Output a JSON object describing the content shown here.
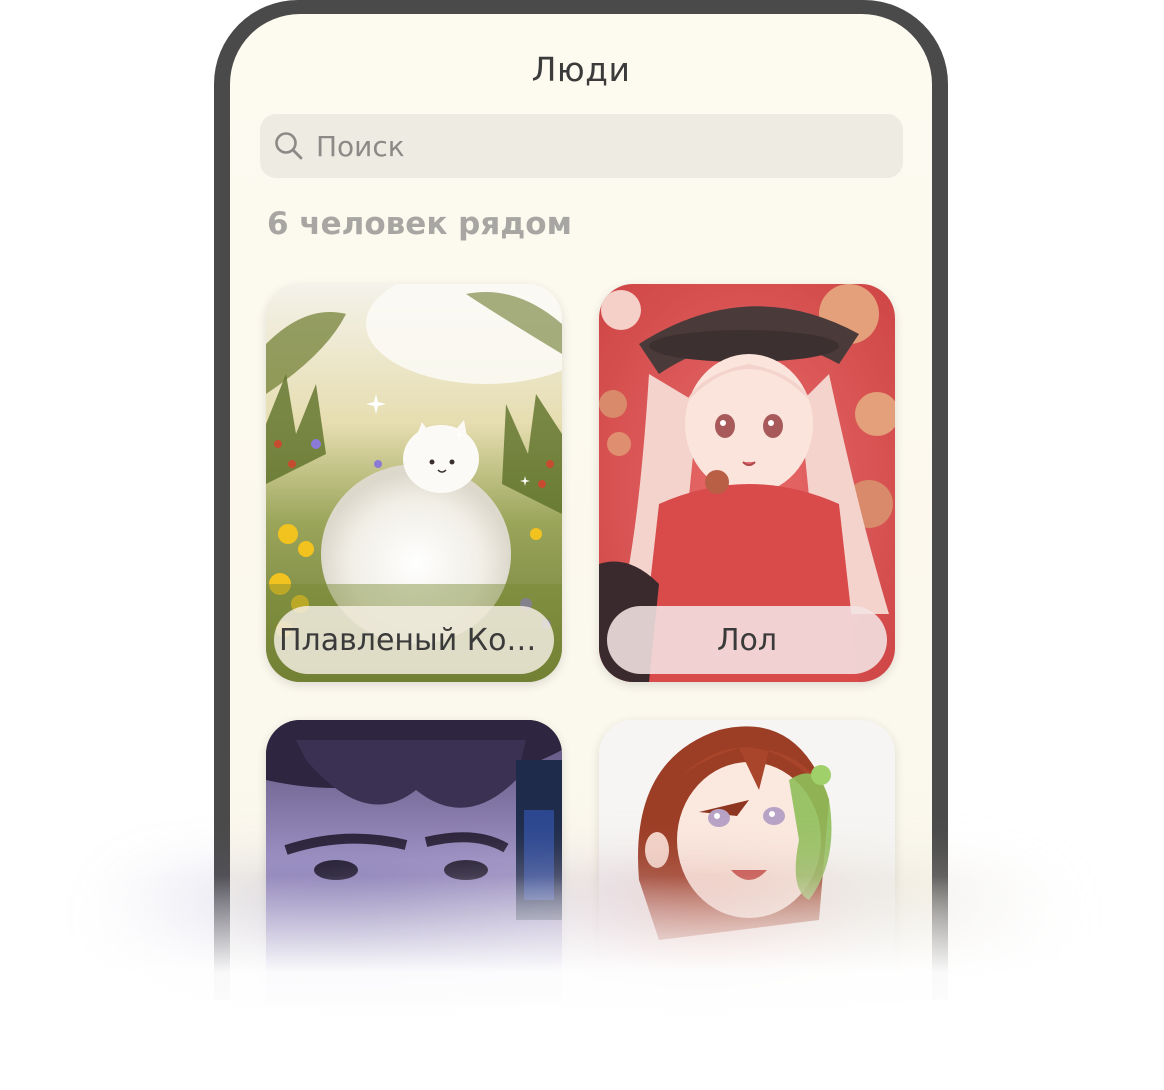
{
  "header": {
    "title": "Люди"
  },
  "search": {
    "placeholder": "Поиск",
    "icon": "search-icon"
  },
  "nearby": {
    "count_label": "6 человек рядом"
  },
  "people": [
    {
      "name": "Плавленый Кот...",
      "image": "white-cat-in-flower-meadow"
    },
    {
      "name": "Лол",
      "image": "anime-girl-red-hat"
    },
    {
      "name": "",
      "image": "man-face-purple-tint"
    },
    {
      "name": "",
      "image": "anime-girl-brown-hair"
    }
  ],
  "colors": {
    "background": "#fdfaf0",
    "frame": "#4a4a4a",
    "search_bg": "#eeebe3",
    "muted_text": "#a7a6a2",
    "title_text": "#3b3b3b"
  }
}
